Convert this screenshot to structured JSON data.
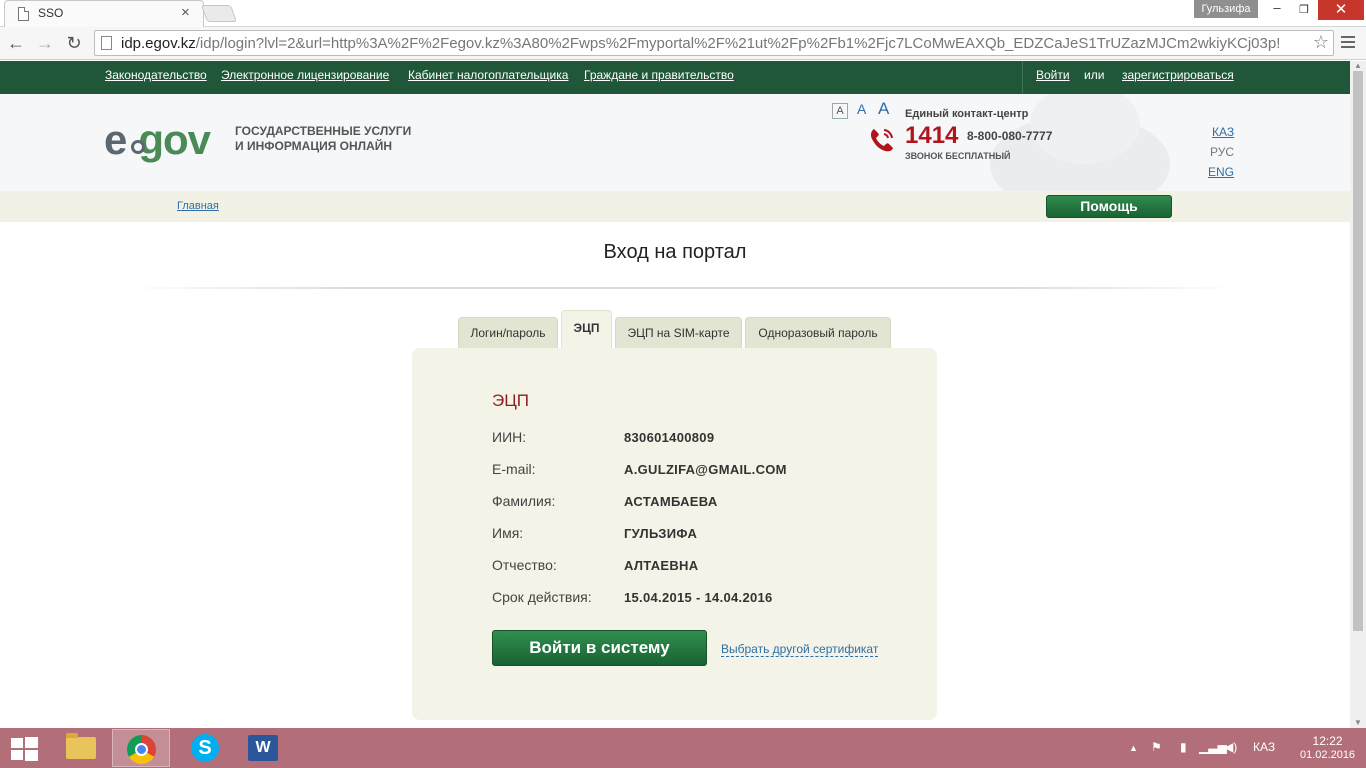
{
  "browser": {
    "tab_title": "SSO",
    "profile_name": "Гульзифа",
    "url_host": "idp.egov.kz",
    "url_path": "/idp/login?lvl=2&url=http%3A%2F%2Fegov.kz%3A80%2Fwps%2Fmyportal%2F%21ut%2Fp%2Fb1%2Fjc7LCoMwEAXQb_EDZCaJeS1TrUZazMJCm2wkiyKCj03p!"
  },
  "topnav": {
    "links": [
      "Законодательство",
      "Электронное лицензирование",
      "Кабинет налогоплательщика",
      "Граждане и правительство"
    ],
    "login": "Войти",
    "or": "или",
    "register": "зарегистрироваться"
  },
  "header": {
    "logo_e": "e",
    "logo_gov": "gov",
    "tagline_line1": "ГОСУДАРСТВЕННЫЕ УСЛУГИ",
    "tagline_line2": "И ИНФОРМАЦИЯ ОНЛАЙН",
    "font_sizes": [
      "A",
      "A",
      "A"
    ],
    "contact_title": "Единый контакт-центр",
    "contact_number": "1414",
    "contact_phone": "8-800-080-7777",
    "contact_free": "ЗВОНОК БЕСПЛАТНЫЙ",
    "languages": [
      "КАЗ",
      "РУС",
      "ENG"
    ]
  },
  "breadcrumb": {
    "home": "Главная",
    "help_button": "Помощь"
  },
  "page": {
    "title": "Вход на портал"
  },
  "auth_tabs": [
    {
      "label": "Логин/пароль"
    },
    {
      "label": "ЭЦП"
    },
    {
      "label": "ЭЦП на SIM-карте"
    },
    {
      "label": "Одноразовый пароль"
    }
  ],
  "certificate": {
    "title": "ЭЦП",
    "rows": [
      {
        "label": "ИИН:",
        "value": "830601400809"
      },
      {
        "label": "E-mail:",
        "value": "A.GULZIFA@GMAIL.COM"
      },
      {
        "label": "Фамилия:",
        "value": "АСТАМБАЕВА"
      },
      {
        "label": "Имя:",
        "value": "ГУЛЬЗИФА"
      },
      {
        "label": "Отчество:",
        "value": "АЛТАЕВНА"
      },
      {
        "label": "Срок действия:",
        "value": "15.04.2015 - 14.04.2016"
      }
    ],
    "login_button": "Войти в систему",
    "other_cert_link": "Выбрать другой сертификат"
  },
  "taskbar": {
    "language": "КАЗ",
    "time": "12:22",
    "date": "01.02.2016"
  },
  "colors": {
    "nav_green": "#1f5738",
    "button_green": "#1f6b38",
    "panel_bg": "#f4f3e7",
    "title_red": "#8b1e1e",
    "taskbar": "#b26f79"
  }
}
